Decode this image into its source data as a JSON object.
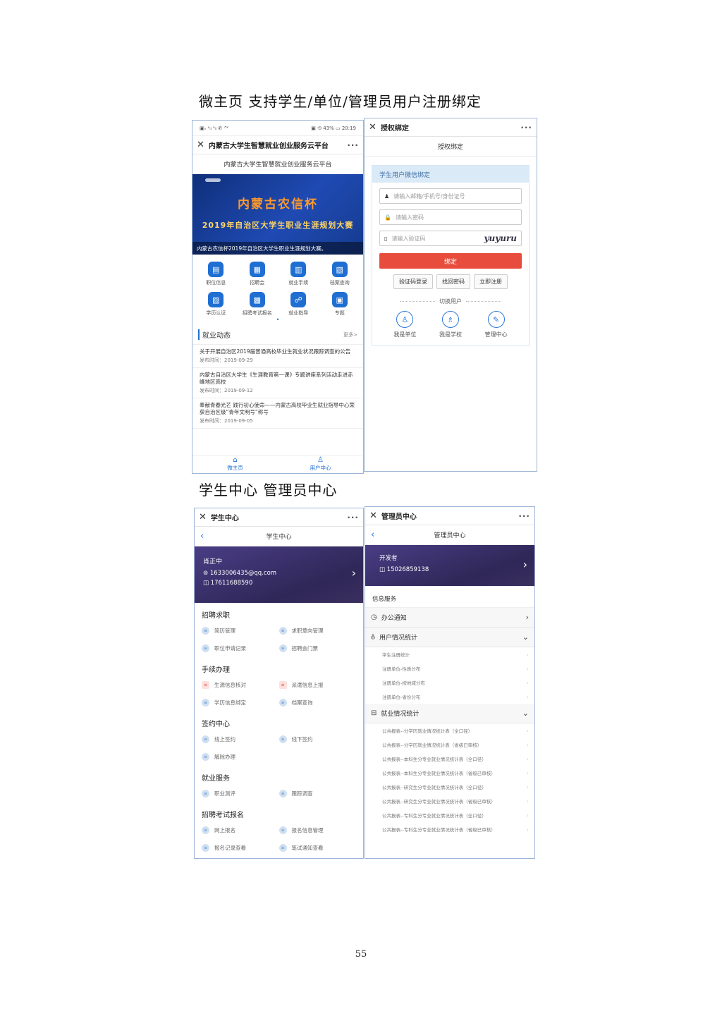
{
  "headings": {
    "top": "微主页  支持学生/单位/管理员用户注册绑定",
    "middle": "学生中心  管理员中心"
  },
  "page_number": "55",
  "home": {
    "status_left": "▣ₙ ᵃᵢₗ ᵃᵢₗ ✆ ⁱ⁵ᵏ",
    "status_right": "▣ ⟲ 43% ▭ 20:19",
    "window_title": "内蒙古大学生智慧就业创业服务云平台",
    "more": "···",
    "page_title": "内蒙古大学生智慧就业创业服务云平台",
    "banner": {
      "title": "内蒙古农信杯",
      "subtitle": "2019年自治区大学生职业生涯规划大赛",
      "caption": "内蒙古农信杯2019年自治区大学生职业生涯规划大赛。"
    },
    "grid": [
      {
        "label": "职位信息",
        "icon": "▤"
      },
      {
        "label": "招聘会",
        "icon": "▦"
      },
      {
        "label": "就业手续",
        "icon": "▥"
      },
      {
        "label": "档案查询",
        "icon": "▧"
      },
      {
        "label": "学历认证",
        "icon": "▨"
      },
      {
        "label": "招聘考试报名",
        "icon": "▩"
      },
      {
        "label": "就业指导",
        "icon": "☍"
      },
      {
        "label": "专题",
        "icon": "▣"
      }
    ],
    "news_title": "就业动态",
    "news_more": "更多>",
    "news": [
      {
        "title": "关于开展自治区2019届普通高校毕业生就业状况跟踪调查的公告",
        "date": "发布时间：2019-09-29"
      },
      {
        "title": "内蒙古自治区大学生《生涯教育第一课》专题讲座系列活动走进赤峰地区高校",
        "date": "发布时间：2019-09-12"
      },
      {
        "title": "奉献青春光芒 践行初心使命——内蒙古高校毕业生就业指导中心荣获自治区级“青年文明号”称号",
        "date": "发布时间：2019-09-05"
      }
    ],
    "tabs": [
      {
        "label": "微主页",
        "icon": "⌂"
      },
      {
        "label": "用户中心",
        "icon": "♙"
      }
    ]
  },
  "bind": {
    "window_title": "授权绑定",
    "more": "···",
    "page_title": "授权绑定",
    "card_title": "学生用户微信绑定",
    "fields": [
      {
        "placeholder": "请输入邮箱/手机号/身份证号",
        "icon": "♟"
      },
      {
        "placeholder": "请输入密码",
        "icon": "🔒"
      },
      {
        "placeholder": "请输入验证码",
        "icon": "▯",
        "captcha": "yuyuru"
      }
    ],
    "bind_button": "绑定",
    "buttons": [
      "验证码登录",
      "找回密码",
      "立即注册"
    ],
    "switch_label": "切换用户",
    "roles": [
      {
        "label": "我是单位",
        "icon": "♙"
      },
      {
        "label": "我是学校",
        "icon": "♗"
      },
      {
        "label": "管理中心",
        "icon": "✎"
      }
    ]
  },
  "student": {
    "window_title": "学生中心",
    "more": "···",
    "page_title": "学生中心",
    "name": "肖正中",
    "email": "⊜ 1633006435@qq.com",
    "phone": "◫ 17611688590",
    "sections": [
      {
        "title": "招聘求职",
        "items": [
          "简历管理",
          "求职意向管理",
          "职位申请记录",
          "招聘会门票"
        ]
      },
      {
        "title": "手续办理",
        "items": [
          "生源信息核对",
          "派遣信息上报",
          "学历信息绑定",
          "档案查询"
        ]
      },
      {
        "title": "签约中心",
        "items": [
          "线上签约",
          "线下签约",
          "解除办理"
        ]
      },
      {
        "title": "就业服务",
        "items": [
          "职业测评",
          "跟踪调查"
        ]
      },
      {
        "title": "招聘考试报名",
        "items": [
          "网上报名",
          "报名信息管理",
          "报名记录查看",
          "笔试通知查看"
        ]
      }
    ]
  },
  "admin": {
    "window_title": "管理员中心",
    "more": "···",
    "page_title": "管理员中心",
    "name": "开发者",
    "phone": "◫ 15026859138",
    "service_label": "信息服务",
    "groups": [
      {
        "title": "办公通知",
        "icon": "◷",
        "arrow": "›",
        "items": []
      },
      {
        "title": "用户情况统计",
        "icon": "⫚",
        "arrow": "⌄",
        "items": [
          "学生注册统计",
          "注册单位-性质分布",
          "注册单位-按地域分布",
          "注册单位-省份分布"
        ]
      },
      {
        "title": "就业情况统计",
        "icon": "⊟",
        "arrow": "⌄",
        "items": [
          "公共报表--分学历就业情况统计表（全口径）",
          "公共报表--分学历就业情况统计表（省级已审核）",
          "公共报表--本科生分专业就业情况统计表（全口径）",
          "公共报表--本科生分专业就业情况统计表（省级已审核）",
          "公共报表--研究生分专业就业情况统计表（全口径）",
          "公共报表--研究生分专业就业情况统计表（省级已审核）",
          "公共报表--专科生分专业就业情况统计表（全口径）",
          "公共报表--专科生分专业就业情况统计表（省级已审核）"
        ]
      }
    ]
  }
}
